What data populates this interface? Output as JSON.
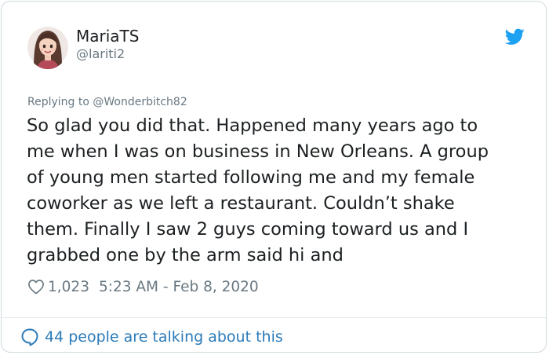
{
  "author": {
    "display_name": "MariaTS",
    "handle": "@lariti2",
    "avatar_icon": "cartoon-woman-avatar"
  },
  "reply_to": "Replying to @Wonderbitch82",
  "tweet": {
    "lines": [
      "So glad you did that. Happened many years ago to",
      "me when I was on business in New Orleans. A group",
      "of young men started following me and my female",
      "coworker as we left a restaurant. Couldn’t shake",
      "them. Finally I saw 2 guys coming toward us and I",
      "grabbed one by the arm said hi and"
    ]
  },
  "meta": {
    "likes": "1,023",
    "timestamp": "5:23 AM - Feb 8, 2020"
  },
  "footer": {
    "talking": "44 people are talking about this"
  },
  "colors": {
    "twitter_blue": "#1da1f2",
    "link_blue": "#2b7bb9",
    "secondary_text": "#697882",
    "primary_text": "#1c2022",
    "border": "#cfd9de"
  }
}
